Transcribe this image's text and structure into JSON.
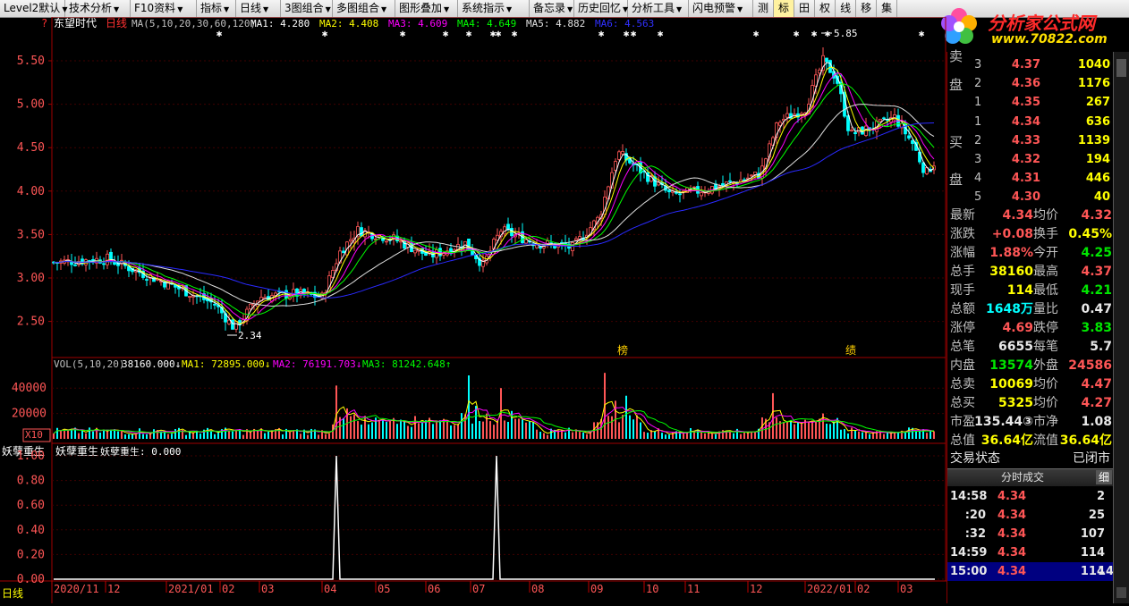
{
  "toolbar": {
    "items": [
      "Level2默认",
      "技术分析",
      "F10资料",
      "指标",
      "日线",
      "3图组合",
      "多图组合",
      "图形叠加",
      "系统指示",
      "备忘录",
      "历史回忆",
      "分析工具",
      "闪电预警"
    ],
    "right_items": [
      "测",
      "标",
      "田",
      "权",
      "线",
      "移",
      "集"
    ]
  },
  "logo": {
    "text1": "分析家公式网",
    "text2": "www.70822.com"
  },
  "main_chart": {
    "stock_name": "东望时代",
    "period": "日线",
    "ma_spec": "MA(5,10,20,30,60,120)",
    "ma_values": [
      {
        "label": "MA1: 4.280",
        "color": "#ffffff"
      },
      {
        "label": "MA2: 4.408",
        "color": "#ffff00"
      },
      {
        "label": "MA3: 4.609",
        "color": "#ff00ff"
      },
      {
        "label": "MA4: 4.649",
        "color": "#00ff00"
      },
      {
        "label": "MA5: 4.882",
        "color": "#e0e0e0"
      },
      {
        "label": "MA6: 4.563",
        "color": "#3030ff"
      }
    ],
    "y_ticks": [
      "5.50",
      "5.00",
      "4.50",
      "4.00",
      "3.50",
      "3.00",
      "2.50"
    ],
    "y_values": [
      5.5,
      5.0,
      4.5,
      4.0,
      3.5,
      3.0,
      2.5
    ],
    "high_label": "5.85",
    "low_label": "2.34",
    "markers": [
      "榜",
      "绩"
    ],
    "question_mark": "?"
  },
  "vol_chart": {
    "spec": "VOL(5,10,20)",
    "value": "38160.000↓",
    "ma1": "MA1: 72895.000↓",
    "ma2": "MA2: 76191.703↓",
    "ma3": "MA3: 81242.648↑",
    "y_ticks": [
      "40000",
      "20000"
    ],
    "unit": "X10"
  },
  "ind_chart": {
    "name1": "妖孽重生",
    "name2": "妖孽重生: 0.000",
    "y_ticks": [
      "1.00",
      "0.80",
      "0.60",
      "0.40",
      "0.20",
      "0.00"
    ]
  },
  "x_axis": [
    "2020/11",
    "12",
    "2021/01",
    "02",
    "03",
    "04",
    "05",
    "06",
    "07",
    "08",
    "09",
    "10",
    "11",
    "12",
    "2022/01",
    "02",
    "03"
  ],
  "period_label": "日线",
  "orderbook": {
    "sell_label1": "卖",
    "sell_label2": "盘",
    "buy_label1": "买",
    "buy_label2": "盘",
    "sell": [
      {
        "lv": "3",
        "price": "4.37",
        "vol": "1040"
      },
      {
        "lv": "2",
        "price": "4.36",
        "vol": "1176"
      },
      {
        "lv": "1",
        "price": "4.35",
        "vol": "267"
      }
    ],
    "buy": [
      {
        "lv": "1",
        "price": "4.34",
        "vol": "636"
      },
      {
        "lv": "2",
        "price": "4.33",
        "vol": "1139"
      },
      {
        "lv": "3",
        "price": "4.32",
        "vol": "194"
      },
      {
        "lv": "4",
        "price": "4.31",
        "vol": "446"
      },
      {
        "lv": "5",
        "price": "4.30",
        "vol": "40"
      }
    ]
  },
  "quote": [
    {
      "l1": "最新",
      "v1": "4.34",
      "c1": "red",
      "l2": "均价",
      "v2": "4.32",
      "c2": "red"
    },
    {
      "l1": "涨跌",
      "v1": "+0.08",
      "c1": "red",
      "l2": "换手",
      "v2": "0.45%",
      "c2": "yellow"
    },
    {
      "l1": "涨幅",
      "v1": "1.88%",
      "c1": "red",
      "l2": "今开",
      "v2": "4.25",
      "c2": "green"
    },
    {
      "l1": "总手",
      "v1": "38160",
      "c1": "yellow",
      "l2": "最高",
      "v2": "4.37",
      "c2": "red"
    },
    {
      "l1": "现手",
      "v1": "114",
      "c1": "yellow",
      "l2": "最低",
      "v2": "4.21",
      "c2": "green"
    },
    {
      "l1": "总额",
      "v1": "1648万",
      "c1": "cyan",
      "l2": "量比",
      "v2": "0.47",
      "c2": "white"
    },
    {
      "l1": "涨停",
      "v1": "4.69",
      "c1": "red",
      "l2": "跌停",
      "v2": "3.83",
      "c2": "green"
    },
    {
      "l1": "总笔",
      "v1": "6655",
      "c1": "white",
      "l2": "每笔",
      "v2": "5.7",
      "c2": "white"
    },
    {
      "l1": "内盘",
      "v1": "13574",
      "c1": "green",
      "l2": "外盘",
      "v2": "24586",
      "c2": "red"
    },
    {
      "l1": "总卖",
      "v1": "10069",
      "c1": "yellow",
      "l2": "均价",
      "v2": "4.47",
      "c2": "red"
    },
    {
      "l1": "总买",
      "v1": "5325",
      "c1": "yellow",
      "l2": "均价",
      "v2": "4.27",
      "c2": "red"
    },
    {
      "l1": "市盈",
      "v1": "135.44③",
      "c1": "white",
      "l2": "市净",
      "v2": "1.08",
      "c2": "white"
    },
    {
      "l1": "总值",
      "v1": "36.64亿",
      "c1": "yellow",
      "l2": "流值",
      "v2": "36.64亿",
      "c2": "yellow"
    }
  ],
  "status": {
    "label": "交易状态",
    "value": "已闭市"
  },
  "ticks_header": {
    "title": "分时成交",
    "btn": "细"
  },
  "ticks": [
    {
      "t": "14:58",
      "p": "4.34",
      "v": "2"
    },
    {
      "t": ":20",
      "p": "4.34",
      "v": "25"
    },
    {
      "t": ":32",
      "p": "4.34",
      "v": "107"
    },
    {
      "t": "14:59",
      "p": "4.34",
      "v": "114"
    },
    {
      "t": "15:00",
      "p": "4.34",
      "v": "114",
      "extra": "14"
    }
  ],
  "colors": {
    "up": "#ff5656",
    "down": "#00ffff",
    "grid": "#800000"
  }
}
